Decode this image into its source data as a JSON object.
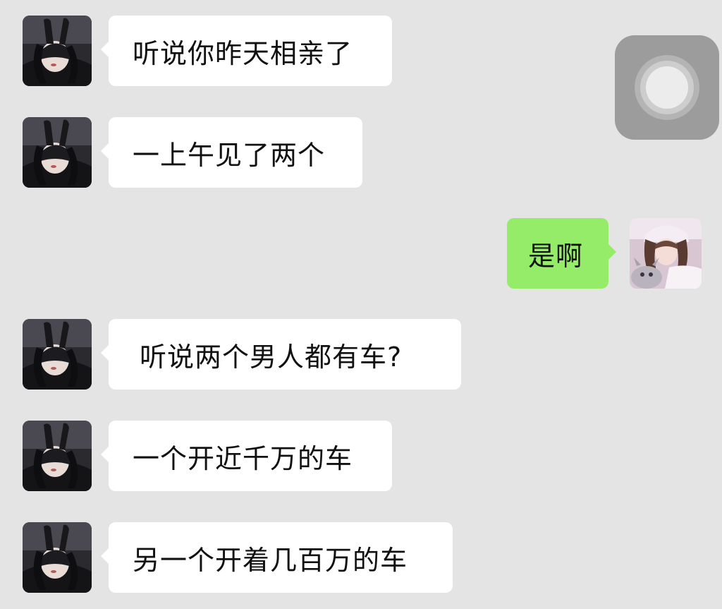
{
  "chat": {
    "messages": [
      {
        "side": "left",
        "text": "听说你昨天相亲了"
      },
      {
        "side": "left",
        "text": "一上午见了两个"
      },
      {
        "side": "right",
        "text": "是啊"
      },
      {
        "side": "left",
        "text": "听说两个男人都有车?"
      },
      {
        "side": "left",
        "text": "一个开近千万的车"
      },
      {
        "side": "left",
        "text": "另一个开着几百万的车"
      }
    ]
  },
  "colors": {
    "background": "#e4e4e4",
    "incoming_bubble": "#ffffff",
    "outgoing_bubble": "#95ec69",
    "text": "#111111"
  },
  "icons": {
    "left_avatar": "bunny-mask-avatar",
    "right_avatar": "girl-with-plush-avatar",
    "floating_button": "assistive-touch-icon"
  }
}
